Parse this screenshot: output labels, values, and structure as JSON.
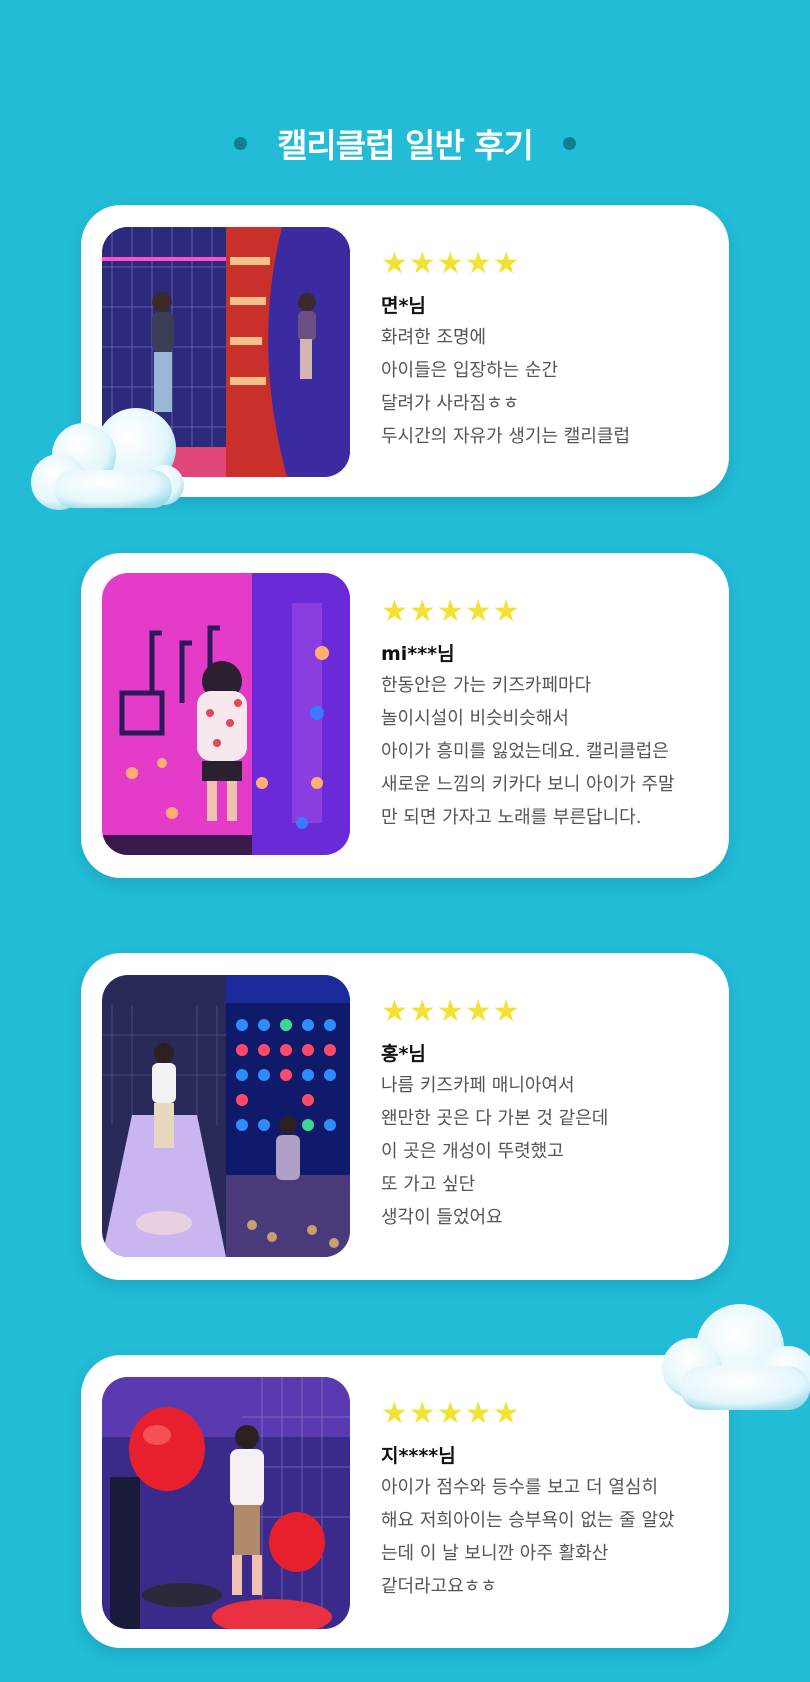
{
  "title": "캘리클럽 일반 후기",
  "colors": {
    "background": "#22bcd6",
    "star": "#f2e234",
    "card": "#ffffff"
  },
  "star_icon": "star-icon",
  "reviews": [
    {
      "rating": 5,
      "reviewer": "면*님",
      "lines": [
        "화려한 조명에",
        "아이들은 입장하는 순간",
        "달려가 사라짐ㅎㅎ",
        "두시간의 자유가 생기는 캘리클럽"
      ]
    },
    {
      "rating": 5,
      "reviewer": "mi***님",
      "lines": [
        "한동안은 가는 키즈카페마다",
        "놀이시설이 비슷비슷해서",
        "아이가 흥미를 잃었는데요. 캘리클럽은",
        "새로운 느낌의 키카다 보니 아이가 주말",
        "만 되면 가자고 노래를 부른답니다."
      ]
    },
    {
      "rating": 5,
      "reviewer": "홍*님",
      "lines": [
        "나름 키즈카페 매니아여서",
        "왠만한 곳은 다 가본 것 같은데",
        "이 곳은 개성이 뚜렷했고",
        "또 가고 싶단",
        "생각이 들었어요"
      ]
    },
    {
      "rating": 5,
      "reviewer": "지****님",
      "lines": [
        "아이가 점수와 등수를 보고 더 열심히",
        "해요 저희아이는 승부욕이 없는 줄 알았",
        "는데 이 날 보니깐 아주 활화산",
        "같더라고요ㅎㅎ"
      ]
    }
  ]
}
